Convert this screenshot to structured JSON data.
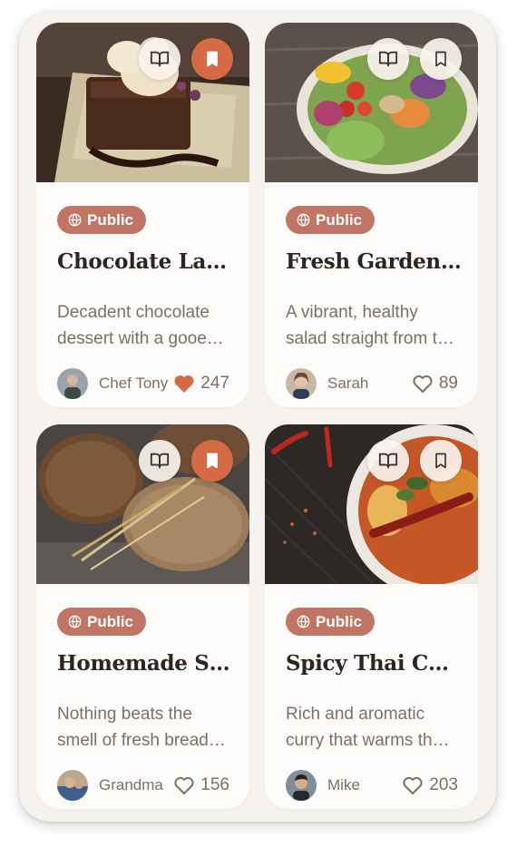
{
  "recipes": [
    {
      "badge": "Public",
      "title": "Chocolate Lava Cake",
      "description": "Decadent chocolate dessert with a gooey molten center",
      "author": "Chef Tony",
      "likes": "247",
      "liked": true,
      "saved": true
    },
    {
      "badge": "Public",
      "title": "Fresh Garden Bowl",
      "description": "A vibrant, healthy salad straight from the garden",
      "author": "Sarah",
      "likes": "89",
      "liked": false,
      "saved": false
    },
    {
      "badge": "Public",
      "title": "Homemade Sourdough",
      "description": "Nothing beats the smell of fresh bread baking",
      "author": "Grandma",
      "likes": "156",
      "liked": false,
      "saved": true
    },
    {
      "badge": "Public",
      "title": "Spicy Thai Curry",
      "description": "Rich and aromatic curry that warms the soul",
      "author": "Mike",
      "likes": "203",
      "liked": false,
      "saved": false
    }
  ],
  "icons": {
    "book": "book-open-icon",
    "save": "bookmark-icon",
    "visibility": "globe-icon",
    "like": "heart-icon"
  },
  "colors": {
    "accent": "#d56a44",
    "badge": "#c17565",
    "title": "#2b2523",
    "muted": "#7a706b",
    "background": "#f6f3ef"
  }
}
